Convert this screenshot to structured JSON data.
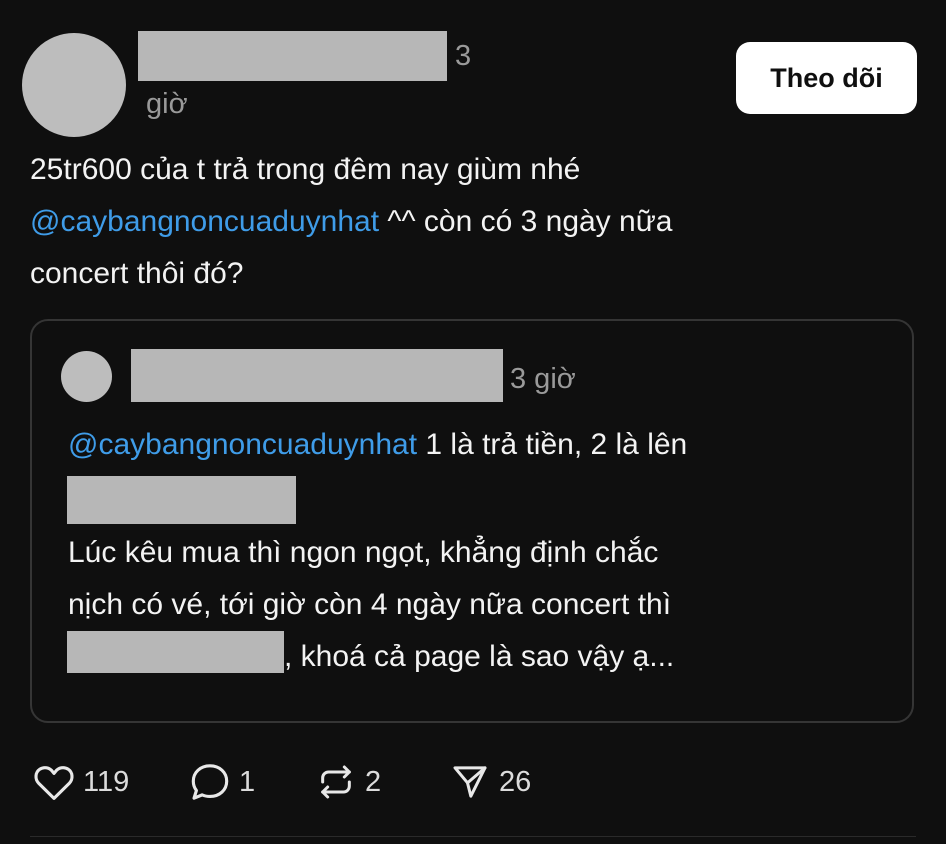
{
  "author": {
    "time_number": "3",
    "time_unit": "giờ"
  },
  "follow_button": {
    "label": "Theo dõi"
  },
  "post": {
    "line1": "25tr600 của t trả trong đêm nay giùm nhé",
    "mention": "@caybangnoncuaduynhat",
    "line2_rest": " ^^ còn có 3 ngày nữa",
    "line3": "concert thôi đó?"
  },
  "quoted_post": {
    "time": "3 giờ",
    "mention": "@caybangnoncuaduynhat",
    "line1_rest": " 1 là trả tiền, 2 là lên",
    "line3": "Lúc kêu mua thì ngon ngọt, khẳng định chắc",
    "line4": "nịch có vé, tới giờ còn 4 ngày nữa concert thì",
    "line5_rest": ", khoá cả page là sao vậy ạ..."
  },
  "actions": {
    "likes": "119",
    "replies": "1",
    "reposts": "2",
    "shares": "26"
  },
  "colors": {
    "background": "#0f0f0f",
    "mention": "#3f9ce8",
    "redaction": "#b7b7b7"
  }
}
